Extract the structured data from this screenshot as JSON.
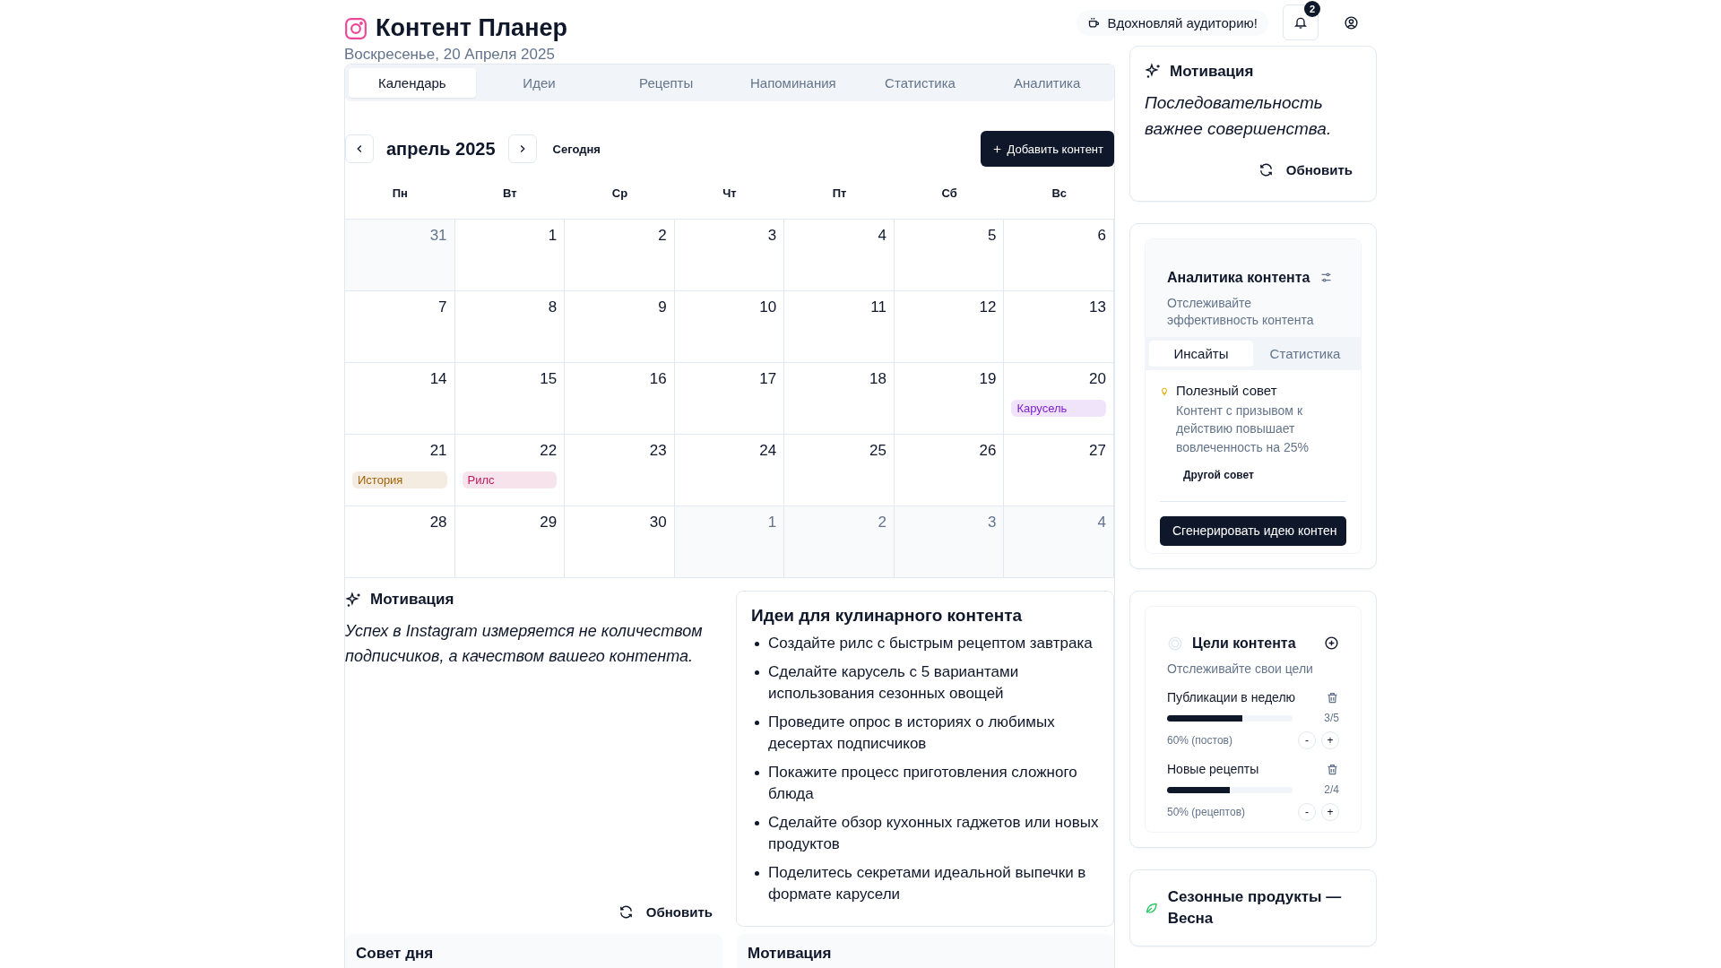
{
  "app": {
    "title": "Контент Планер",
    "date": "Воскресенье, 20 Апреля 2025"
  },
  "header": {
    "inspire": "Вдохновляй аудиторию!",
    "notifications": "2"
  },
  "tabs": [
    {
      "label": "Календарь",
      "selected": true
    },
    {
      "label": "Идеи",
      "selected": false
    },
    {
      "label": "Рецепты",
      "selected": false
    },
    {
      "label": "Напоминания",
      "selected": false
    },
    {
      "label": "Статистика",
      "selected": false
    },
    {
      "label": "Аналитика",
      "selected": false
    }
  ],
  "calendar": {
    "month": "апрель 2025",
    "today": "Сегодня",
    "add": "Добавить контент",
    "weekdays": [
      "Пн",
      "Вт",
      "Ср",
      "Чт",
      "Пт",
      "Сб",
      "Вс"
    ],
    "weeks": [
      [
        {
          "day": "31",
          "muted": true
        },
        {
          "day": "1",
          "muted": false
        },
        {
          "day": "2",
          "muted": false
        },
        {
          "day": "3",
          "muted": false
        },
        {
          "day": "4",
          "muted": false
        },
        {
          "day": "5",
          "muted": false
        },
        {
          "day": "6",
          "muted": false
        }
      ],
      [
        {
          "day": "7",
          "muted": false
        },
        {
          "day": "8",
          "muted": false
        },
        {
          "day": "9",
          "muted": false
        },
        {
          "day": "10",
          "muted": false
        },
        {
          "day": "11",
          "muted": false
        },
        {
          "day": "12",
          "muted": false
        },
        {
          "day": "13",
          "muted": false
        }
      ],
      [
        {
          "day": "14",
          "muted": false
        },
        {
          "day": "15",
          "muted": false
        },
        {
          "day": "16",
          "muted": false
        },
        {
          "day": "17",
          "muted": false
        },
        {
          "day": "18",
          "muted": false
        },
        {
          "day": "19",
          "muted": false
        },
        {
          "day": "20",
          "muted": false,
          "events": [
            {
              "label": "Карусель",
              "color": "#7e22ce"
            }
          ]
        }
      ],
      [
        {
          "day": "21",
          "muted": false,
          "events": [
            {
              "label": "История",
              "color": "#a16207"
            }
          ]
        },
        {
          "day": "22",
          "muted": false,
          "events": [
            {
              "label": "Рилс",
              "color": "#be185d"
            }
          ]
        },
        {
          "day": "23",
          "muted": false
        },
        {
          "day": "24",
          "muted": false
        },
        {
          "day": "25",
          "muted": false
        },
        {
          "day": "26",
          "muted": false
        },
        {
          "day": "27",
          "muted": false
        }
      ],
      [
        {
          "day": "28",
          "muted": false
        },
        {
          "day": "29",
          "muted": false
        },
        {
          "day": "30",
          "muted": false
        },
        {
          "day": "1",
          "muted": true
        },
        {
          "day": "2",
          "muted": true
        },
        {
          "day": "3",
          "muted": true
        },
        {
          "day": "4",
          "muted": true
        }
      ]
    ]
  },
  "motivation": {
    "title": "Мотивация",
    "quote": "Успех в Instagram измеряется не количеством подписчиков, а качеством вашего контента.",
    "refresh": "Обновить"
  },
  "ideas": {
    "title": "Идеи для кулинарного контента",
    "items": [
      "Создайте рилс с быстрым рецептом завтрака",
      "Сделайте карусель с 5 вариантами использования сезонных овощей",
      "Проведите опрос в историях о любимых десертах подписчиков",
      "Покажите процесс приготовления сложного блюда",
      "Сделайте обзор кухонных гаджетов или новых продуктов",
      "Поделитесь секретами идеальной выпечки в формате карусели"
    ]
  },
  "bottom_cards": [
    "Совет дня",
    "Мотивация"
  ],
  "sidebar": {
    "motivation": {
      "title": "Мотивация",
      "quote": "Последовательность важнее совершенства.",
      "refresh": "Обновить"
    },
    "analytics": {
      "title": "Аналитика контента",
      "subtitle": "Отслеживайте эффективность контента",
      "tabs": [
        {
          "label": "Инсайты",
          "selected": true
        },
        {
          "label": "Статистика",
          "selected": false
        }
      ],
      "tip": {
        "title": "Полезный совет",
        "text": "Контент с призывом к действию повышает вовлеченность на 25%",
        "more": "Другой совет"
      },
      "generate": "Сгенерировать идею контен"
    },
    "goals": {
      "title": "Цели контента",
      "subtitle": "Отслеживайте свои цели",
      "items": [
        {
          "name": "Публикации в неделю",
          "ratio": "3/5",
          "level": 0.6,
          "percent": "60% (постов)",
          "minus": "-",
          "plus": "+"
        },
        {
          "name": "Новые рецепты",
          "ratio": "2/4",
          "level": 0.5,
          "percent": "50% (рецептов)",
          "minus": "-",
          "plus": "+"
        }
      ]
    },
    "seasonal": {
      "title": "Сезонные продукты — Весна"
    }
  }
}
